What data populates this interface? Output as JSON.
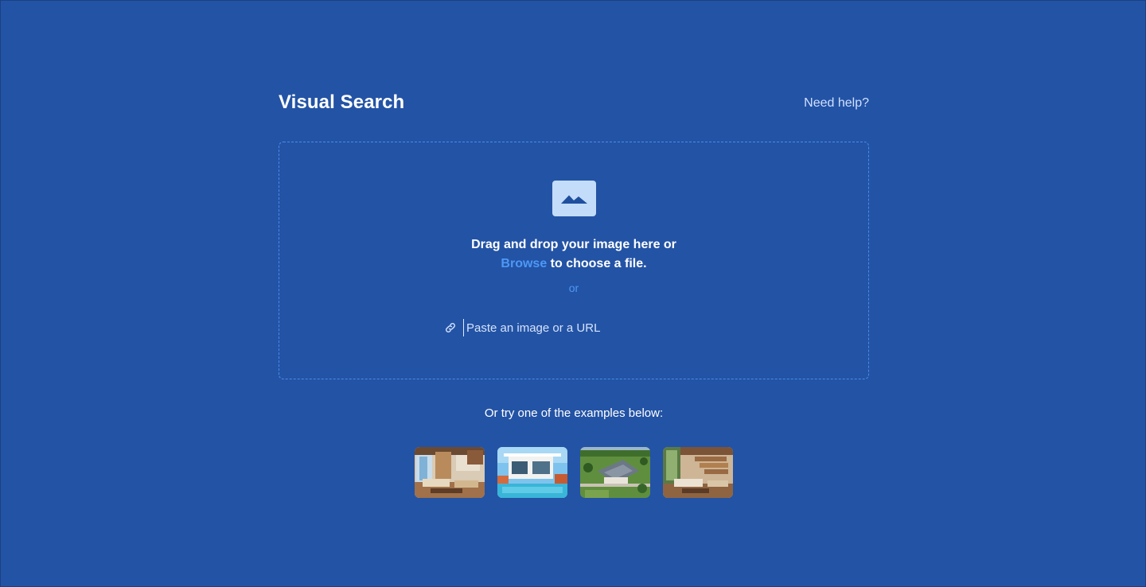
{
  "header": {
    "title": "Visual Search",
    "help_link": "Need help?"
  },
  "dropzone": {
    "icon": "image-icon",
    "line1": "Drag and drop your image here or",
    "browse_label": "Browse",
    "line2_rest": " to choose a file.",
    "or_label": "or",
    "url_icon": "link-icon",
    "url_placeholder": "Paste an image or a URL"
  },
  "examples": {
    "label": "Or try one of the examples below:",
    "items": [
      {
        "subject": "modern living room with large windows"
      },
      {
        "subject": "white modern villa with pool"
      },
      {
        "subject": "aerial view of house with grounds"
      },
      {
        "subject": "open-plan living area with stairs"
      }
    ]
  },
  "colors": {
    "background": "#2353a5",
    "accent": "#4d98f7",
    "dropzone_border": "#4a8bea",
    "icon_tile": "#c3dcfa"
  }
}
